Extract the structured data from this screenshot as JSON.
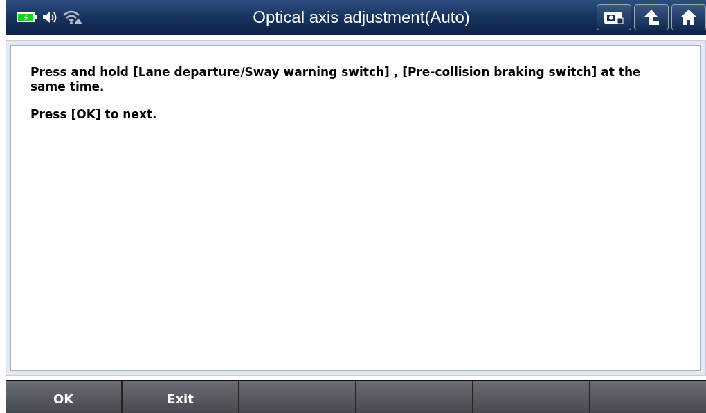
{
  "window": {
    "title": "Optical axis adjustment(Auto)"
  },
  "message": {
    "paragraphs": [
      "Press and hold [Lane departure/Sway warning switch] , [Pre-collision braking switch] at the same time.",
      "Press [OK] to next."
    ]
  },
  "function_keys": [
    {
      "label": "OK"
    },
    {
      "label": "Exit"
    }
  ]
}
